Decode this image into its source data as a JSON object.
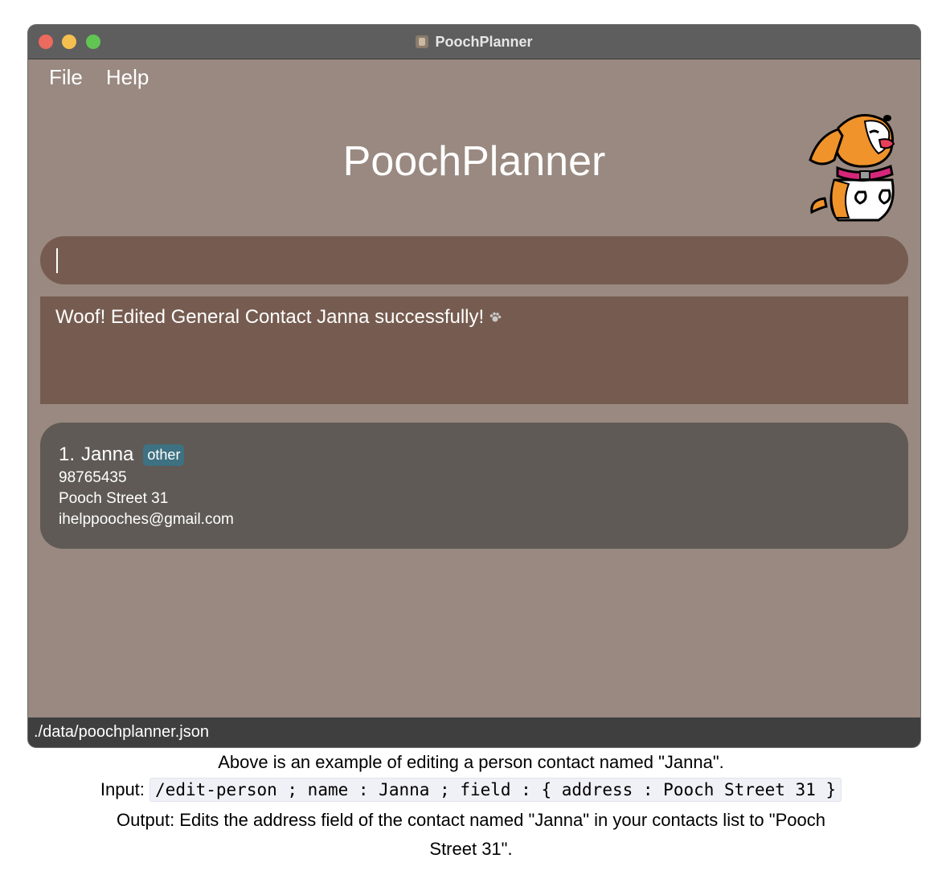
{
  "window": {
    "title": "PoochPlanner"
  },
  "menu": {
    "items": [
      "File",
      "Help"
    ]
  },
  "app": {
    "heading": "PoochPlanner"
  },
  "command": {
    "value": ""
  },
  "result": {
    "message": "Woof! Edited General Contact Janna successfully!"
  },
  "contacts": [
    {
      "index": "1.",
      "name": "Janna",
      "tag": "other",
      "phone": "98765435",
      "address": "Pooch Street 31",
      "email": "ihelppooches@gmail.com"
    }
  ],
  "status": {
    "path": "./data/poochplanner.json"
  },
  "caption": {
    "line1": "Above is an example of editing a person contact named \"Janna\".",
    "input_label": "Input:",
    "input_code": "/edit-person ; name : Janna ; field : { address : Pooch Street 31 }",
    "output_line1": "Output: Edits the address field of the contact named \"Janna\" in your contacts list to \"Pooch",
    "output_line2": "Street 31\"."
  },
  "colors": {
    "window_bg": "#998980",
    "panel_bg": "#765c50",
    "card_bg": "#5f5a55",
    "tag_bg": "#3e7181",
    "status_bg": "#3f3f3f"
  },
  "icons": [
    "mascot-dog-icon",
    "paw-icon",
    "app-icon"
  ]
}
